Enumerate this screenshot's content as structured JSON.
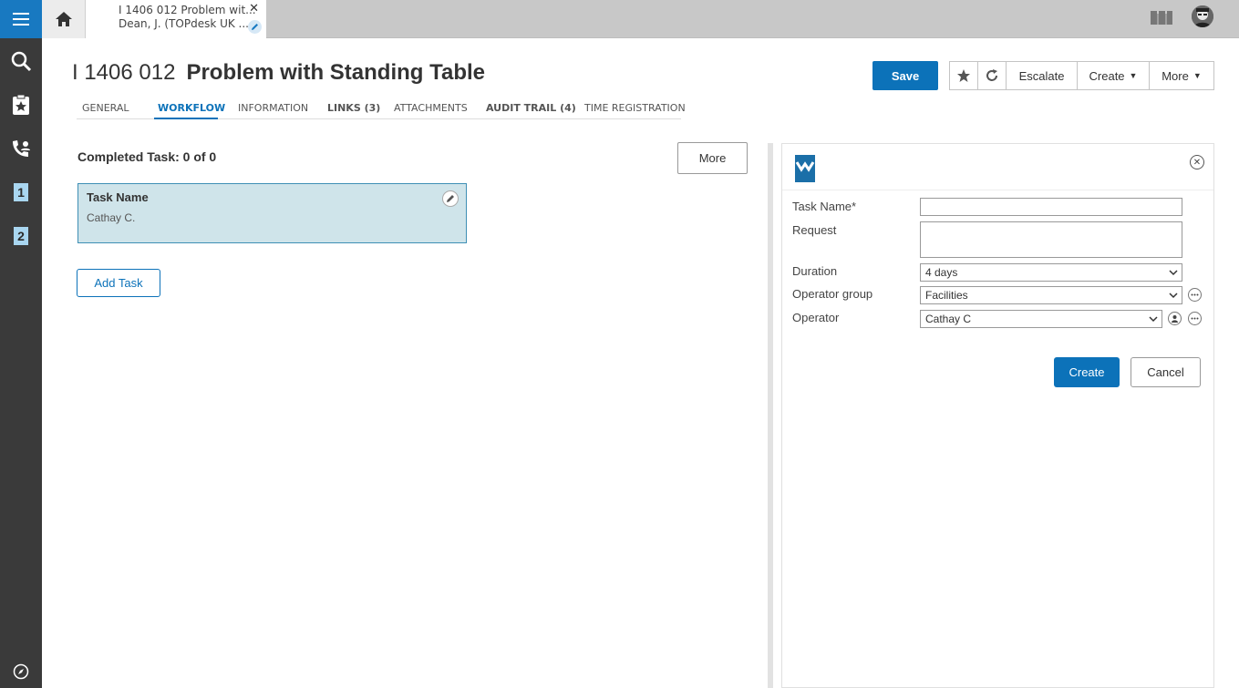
{
  "nav": {
    "menu_icon": "hamburger-menu-icon",
    "items": [
      {
        "icon": "search-icon"
      },
      {
        "icon": "clipboard-star-icon"
      },
      {
        "icon": "phone-user-icon"
      },
      {
        "icon": "badge-1-icon",
        "label": "1"
      },
      {
        "icon": "badge-2-icon",
        "label": "2"
      }
    ],
    "bottom_icon": "compass-icon"
  },
  "topbar": {
    "tab_line1": "I 1406 012 Problem wit...",
    "tab_line2": "Dean, J.  (TOPdesk UK ...",
    "close_glyph": "✕"
  },
  "header": {
    "number": "I 1406 012",
    "title": "Problem with Standing Table",
    "save_label": "Save",
    "escalate_label": "Escalate",
    "create_label": "Create",
    "more_label": "More"
  },
  "tabs": [
    {
      "label": "GENERAL"
    },
    {
      "label": "WORKFLOW",
      "active": true
    },
    {
      "label": "INFORMATION"
    },
    {
      "label": "LINKS (3)"
    },
    {
      "label": "ATTACHMENTS"
    },
    {
      "label": "AUDIT TRAIL (4)"
    },
    {
      "label": "TIME REGISTRATION"
    }
  ],
  "workflow": {
    "completed_text": "Completed Task: 0 of 0",
    "more_label": "More",
    "task": {
      "name": "Task Name",
      "operator": "Cathay C."
    },
    "add_task_label": "Add Task"
  },
  "form": {
    "close_glyph": "✕",
    "task_name_label": "Task Name*",
    "task_name_value": "",
    "request_label": "Request",
    "request_value": "",
    "duration_label": "Duration",
    "duration_value": "4 days",
    "operator_group_label": "Operator group",
    "operator_group_value": "Facilities",
    "operator_label": "Operator",
    "operator_value": "Cathay C",
    "create_label": "Create",
    "cancel_label": "Cancel"
  },
  "colors": {
    "accent": "#0c72b9",
    "rail": "#3a3a3a",
    "card": "#cfe4ea"
  }
}
